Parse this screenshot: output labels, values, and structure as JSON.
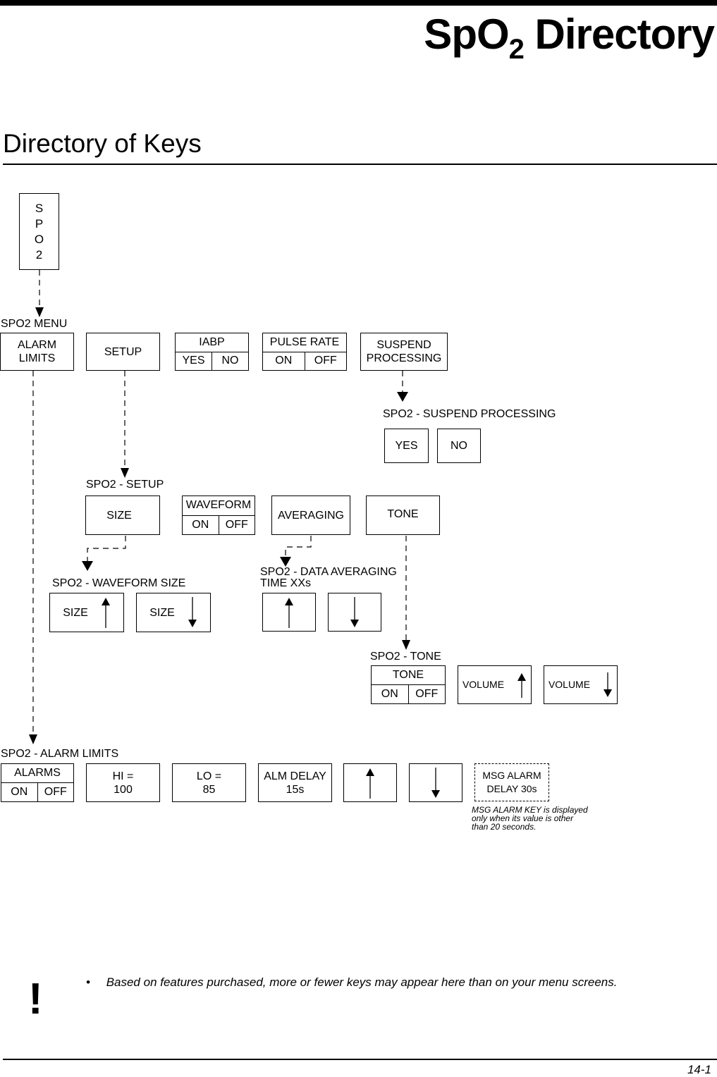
{
  "header": {
    "title_main": "SpO",
    "title_sub": "2",
    "title_rest": " Directory"
  },
  "section_title": "Directory of Keys",
  "root_key": {
    "letters": [
      "S",
      "P",
      "O",
      "2"
    ]
  },
  "spo2_menu": {
    "label": "SPO2 MENU",
    "alarm_limits": "ALARM\nLIMITS",
    "alarm_limits_l1": "ALARM",
    "alarm_limits_l2": "LIMITS",
    "setup": "SETUP",
    "iabp": {
      "title": "IABP",
      "opt1": "YES",
      "opt2": "NO"
    },
    "pulse_rate": {
      "title": "PULSE RATE",
      "opt1": "ON",
      "opt2": "OFF"
    },
    "suspend_l1": "SUSPEND",
    "suspend_l2": "PROCESSING"
  },
  "suspend_menu": {
    "label": "SPO2 - SUSPEND PROCESSING",
    "yes": "YES",
    "no": "NO"
  },
  "setup_menu": {
    "label": "SPO2 - SETUP",
    "size": "SIZE",
    "waveform": {
      "title": "WAVEFORM",
      "opt1": "ON",
      "opt2": "OFF"
    },
    "averaging": "AVERAGING",
    "tone": "TONE"
  },
  "waveform_size_menu": {
    "label": "SPO2 - WAVEFORM SIZE",
    "size_up": "SIZE",
    "size_down": "SIZE"
  },
  "averaging_menu": {
    "label_l1": "SPO2 - DATA AVERAGING",
    "label_l2": "TIME XXs"
  },
  "tone_menu": {
    "label": "SPO2 - TONE",
    "tone": {
      "title": "TONE",
      "opt1": "ON",
      "opt2": "OFF"
    },
    "volume_up": "VOLUME",
    "volume_down": "VOLUME"
  },
  "alarm_limits_menu": {
    "label": "SPO2 - ALARM LIMITS",
    "alarms": {
      "title": "ALARMS",
      "opt1": "ON",
      "opt2": "OFF"
    },
    "hi_label": "HI =",
    "hi_value": "100",
    "lo_label": "LO =",
    "lo_value": "85",
    "delay_label": "ALM DELAY",
    "delay_value": "15s",
    "msg_alarm_l1": "MSG ALARM",
    "msg_alarm_l2": "DELAY 30s",
    "msg_note_l1": "MSG ALARM KEY is displayed",
    "msg_note_l2": "only when its value is other",
    "msg_note_l3": "than 20 seconds."
  },
  "notice": {
    "icon": "exclamation-icon",
    "bullet": "•",
    "text": "Based on features purchased, more or fewer keys may appear here than on your menu screens."
  },
  "footer": {
    "page_number": "14-1"
  }
}
